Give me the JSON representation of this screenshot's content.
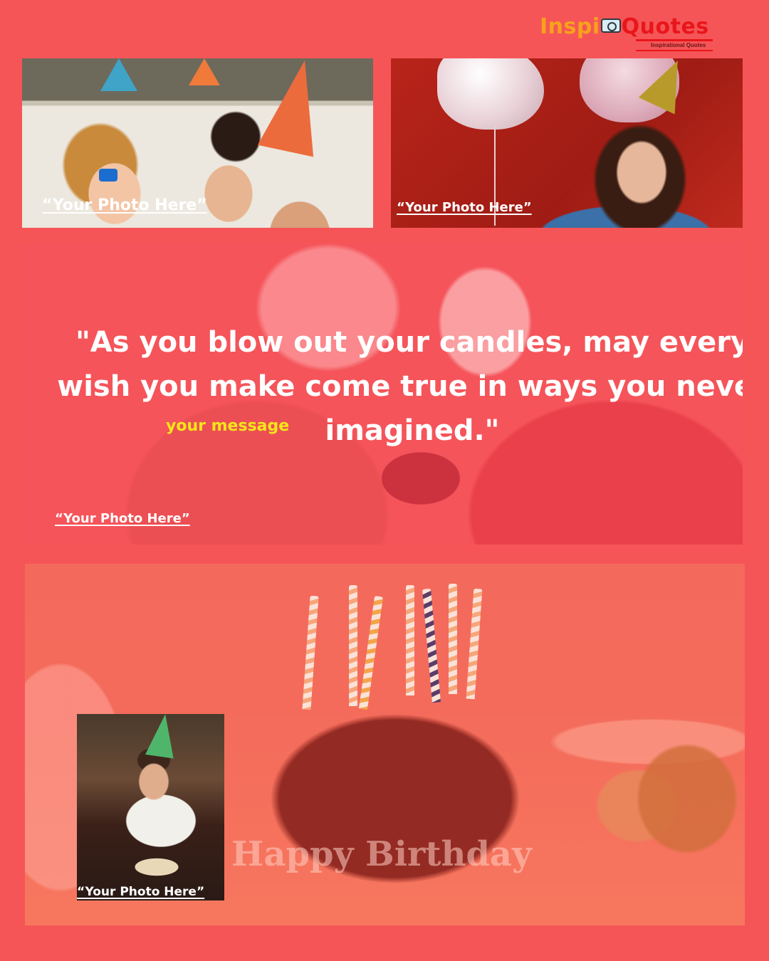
{
  "logo": {
    "part_a": "Inspi",
    "part_b": "Quotes",
    "tagline": "Inspirational Quotes",
    "icon": "camera-icon",
    "colors": {
      "part_a": "#f7a21b",
      "part_b": "#e8161b"
    }
  },
  "photos": {
    "top_left_caption": "“Your Photo Here”",
    "top_right_caption": "“Your Photo Here”",
    "middle_caption": "“Your Photo Here”",
    "inset_caption": "“Your Photo Here”"
  },
  "quote": {
    "line1": "\"As you blow out your candles, may every",
    "line2": "wish you make come true in ways you never",
    "line3": "imagined.\""
  },
  "your_message": "your message",
  "cake_text": "Happy Birthday",
  "colors": {
    "background": "#f65557",
    "quote_text": "#ffffff",
    "message_text": "#f4e51b"
  }
}
